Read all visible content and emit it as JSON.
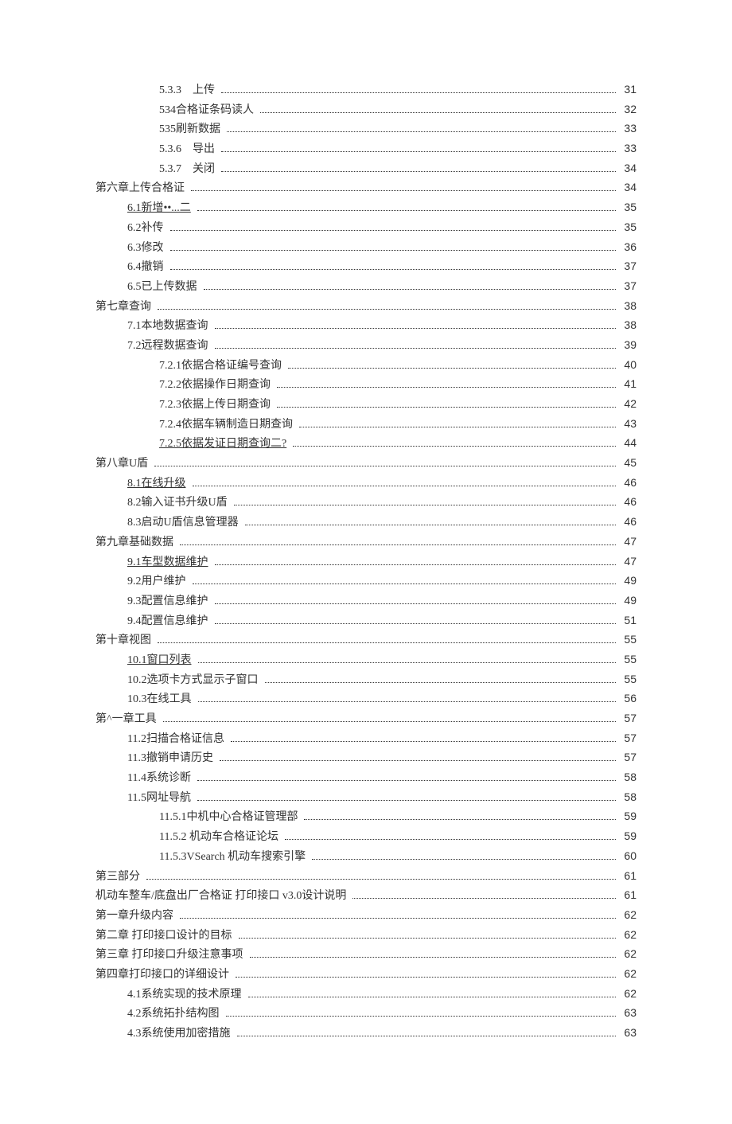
{
  "toc": [
    {
      "indent": 2,
      "label": "5.3.3　上传",
      "page": "31",
      "underline": false
    },
    {
      "indent": 2,
      "label": "534合格证条码读人",
      "page": "32",
      "underline": false
    },
    {
      "indent": 2,
      "label": "535刷新数据",
      "page": "33",
      "underline": false
    },
    {
      "indent": 2,
      "label": "5.3.6　导出",
      "page": "33",
      "underline": false
    },
    {
      "indent": 2,
      "label": "5.3.7　关闭",
      "page": "34",
      "underline": false
    },
    {
      "indent": 0,
      "label": "第六章上传合格证",
      "page": "34",
      "underline": false
    },
    {
      "indent": 1,
      "label": "6.1新增••...二",
      "page": "35",
      "underline": true
    },
    {
      "indent": 1,
      "label": "6.2补传",
      "page": "35",
      "underline": false
    },
    {
      "indent": 1,
      "label": "6.3修改",
      "page": "36",
      "underline": false
    },
    {
      "indent": 1,
      "label": "6.4撤销",
      "page": "37",
      "underline": false
    },
    {
      "indent": 1,
      "label": "6.5已上传数据",
      "page": "37",
      "underline": false
    },
    {
      "indent": 0,
      "label": "第七章查询",
      "page": "38",
      "underline": false
    },
    {
      "indent": 1,
      "label": "7.1本地数据查询",
      "page": "38",
      "underline": false
    },
    {
      "indent": 1,
      "label": "7.2远程数据查询",
      "page": "39",
      "underline": false
    },
    {
      "indent": 2,
      "label": "7.2.1依据合格证编号查询",
      "page": "40",
      "underline": false
    },
    {
      "indent": 2,
      "label": "7.2.2依据操作日期查询",
      "page": "41",
      "underline": false
    },
    {
      "indent": 2,
      "label": "7.2.3依据上传日期查询",
      "page": "42",
      "underline": false
    },
    {
      "indent": 2,
      "label": "7.2.4依据车辆制造日期查询",
      "page": "43",
      "underline": false
    },
    {
      "indent": 2,
      "label": "7.2.5依据发证日期查询二?",
      "page": "44",
      "underline": true
    },
    {
      "indent": 0,
      "label": "第八章U盾",
      "page": "45",
      "underline": false
    },
    {
      "indent": 1,
      "label": "8.1在线升级",
      "page": "46",
      "underline": true
    },
    {
      "indent": 1,
      "label": "8.2输入证书升级U盾",
      "page": "46",
      "underline": false
    },
    {
      "indent": 1,
      "label": "8.3启动U盾信息管理器",
      "page": "46",
      "underline": false
    },
    {
      "indent": 0,
      "label": "第九章基础数据",
      "page": "47",
      "underline": false
    },
    {
      "indent": 1,
      "label": "9.1车型数据维护",
      "page": "47",
      "underline": true
    },
    {
      "indent": 1,
      "label": "9.2用户维护",
      "page": "49",
      "underline": false
    },
    {
      "indent": 1,
      "label": "9.3配置信息维护",
      "page": "49",
      "underline": false
    },
    {
      "indent": 1,
      "label": "9.4配置信息维护",
      "page": "51",
      "underline": false
    },
    {
      "indent": 0,
      "label": "第十章视图",
      "page": "55",
      "underline": false
    },
    {
      "indent": 1,
      "label": "10.1窗口列表",
      "page": "55",
      "underline": true
    },
    {
      "indent": 1,
      "label": "10.2选项卡方式显示子窗口",
      "page": "55",
      "underline": false
    },
    {
      "indent": 1,
      "label": "10.3在线工具",
      "page": "56",
      "underline": false
    },
    {
      "indent": 0,
      "label": "第^一章工具",
      "page": "57",
      "underline": false
    },
    {
      "indent": 1,
      "label": "11.2扫描合格证信息",
      "page": "57",
      "underline": false
    },
    {
      "indent": 1,
      "label": "11.3撤销申请历史",
      "page": "57",
      "underline": false
    },
    {
      "indent": 1,
      "label": "11.4系统诊断",
      "page": "58",
      "underline": false
    },
    {
      "indent": 1,
      "label": "11.5网址导航",
      "page": "58",
      "underline": false
    },
    {
      "indent": 2,
      "label": "11.5.1中机中心合格证管理部",
      "page": "59",
      "underline": false
    },
    {
      "indent": 2,
      "label": "11.5.2 机动车合格证论坛",
      "page": "59",
      "underline": false
    },
    {
      "indent": 2,
      "label": "11.5.3VSearch 机动车搜索引擎",
      "page": "60",
      "underline": false
    },
    {
      "indent": 0,
      "label": " 第三部分",
      "page": "61",
      "underline": false
    },
    {
      "indent": 0,
      "label": "机动车整车/底盘出厂合格证 打印接口 v3.0设计说明",
      "page": "61",
      "underline": false
    },
    {
      "indent": 0,
      "label": "第一章升级内容",
      "page": "62",
      "underline": false
    },
    {
      "indent": 0,
      "label": "第二章 打印接口设计的目标",
      "page": "62",
      "underline": false
    },
    {
      "indent": 0,
      "label": "第三章 打印接口升级注意事项",
      "page": "62",
      "underline": false
    },
    {
      "indent": 0,
      "label": "第四章打印接口的详细设计",
      "page": "62",
      "underline": false
    },
    {
      "indent": 1,
      "label": "4.1系统实现的技术原理",
      "page": "62",
      "underline": false
    },
    {
      "indent": 1,
      "label": "4.2系统拓扑结构图",
      "page": "63",
      "underline": false
    },
    {
      "indent": 1,
      "label": "4.3系统使用加密措施",
      "page": "63",
      "underline": false
    }
  ]
}
